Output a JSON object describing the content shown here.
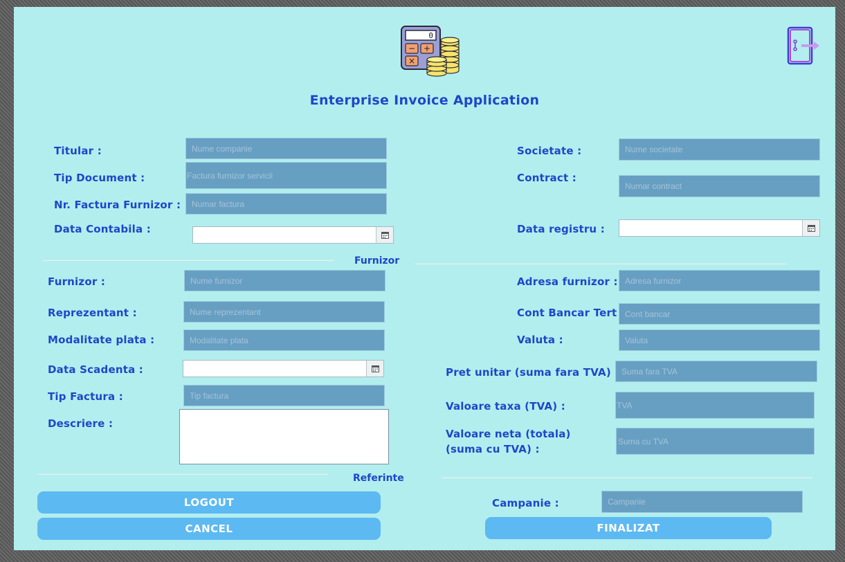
{
  "app": {
    "title": "Enterprise Invoice Application",
    "logo_icon": "calculator-coins-icon",
    "exit_icon": "logout-door-icon"
  },
  "labels": {
    "titular": "Titular :",
    "tip_document": "Tip Document :",
    "nr_factura": "Nr. Factura Furnizor :",
    "data_contabila": "Data Contabila :",
    "societate": "Societate :",
    "contract": "Contract :",
    "data_registru": "Data registru :",
    "furnizor": "Furnizor :",
    "reprezentant": "Reprezentant :",
    "modalitate_plata": "Modalitate plata :",
    "data_scadenta": "Data Scadenta :",
    "tip_factura": "Tip Factura :",
    "descriere": "Descriere :",
    "adresa_furnizor": "Adresa furnizor :",
    "cont_bancar": "Cont Bancar Tert :",
    "valuta": "Valuta :",
    "pret_unitar": "Pret unitar (suma fara TVA) :",
    "valoare_taxa": "Valoare taxa (TVA) :",
    "valoare_neta_1": "Valoare neta (totala)",
    "valoare_neta_2": "(suma cu TVA) :",
    "campanie": "Campanie :"
  },
  "placeholders": {
    "titular": "Nume companie",
    "tip_document": "Factura furnizor servicii",
    "nr_factura": "Numar factura",
    "societate": "Nume societate",
    "contract": "Numar contract",
    "furnizor": "Nume furnizor",
    "reprezentant": "Nume reprezentant",
    "modalitate_plata": "Modalitate plata",
    "tip_factura": "Tip factura",
    "adresa_furnizor": "Adresa furnizor",
    "cont_bancar": "Cont bancar",
    "valuta": "Valuta",
    "pret_unitar": "Suma fara TVA",
    "valoare_taxa": "TVA",
    "valoare_neta": "Suma cu TVA",
    "campanie": "Campanie"
  },
  "sections": {
    "furnizor": "Furnizor",
    "referinte": "Referinte"
  },
  "buttons": {
    "logout": "LOGOUT",
    "cancel": "CANCEL",
    "finalizat": "FINALIZAT"
  },
  "calculator_display": "0",
  "icons": {
    "calendar": "calendar-icon"
  },
  "colors": {
    "panel_bg": "#b2eeee",
    "label": "#1f46c8",
    "field_bg": "#679fc3",
    "button_bg": "#5db9f2"
  }
}
